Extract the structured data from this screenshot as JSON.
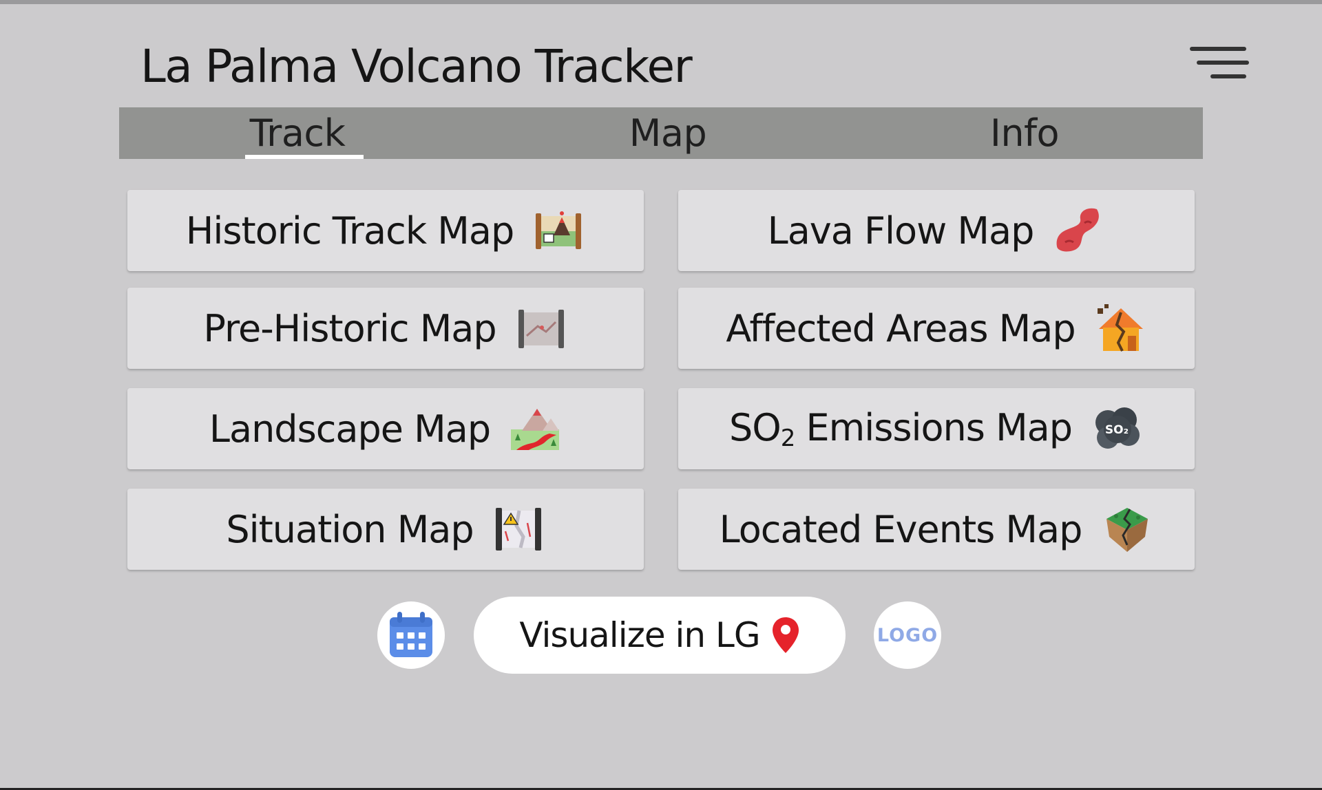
{
  "app": {
    "title": "La Palma Volcano Tracker"
  },
  "tabs": [
    {
      "label": "Track",
      "active": true
    },
    {
      "label": "Map",
      "active": false
    },
    {
      "label": "Info",
      "active": false
    }
  ],
  "track_buttons": {
    "historic": {
      "label": "Historic Track Map",
      "icon": "historic-map-icon"
    },
    "lava_flow": {
      "label": "Lava Flow Map",
      "icon": "lava-flow-icon"
    },
    "prehistoric": {
      "label": "Pre-Historic Map",
      "icon": "prehistoric-map-icon"
    },
    "affected_areas": {
      "label": "Affected Areas Map",
      "icon": "house-damage-icon"
    },
    "landscape": {
      "label": "Landscape Map",
      "icon": "landscape-icon"
    },
    "so2": {
      "label_prefix": "SO",
      "label_sub": "2",
      "label_suffix": " Emissions Map",
      "icon": "so2-cloud-icon",
      "icon_text": "SO₂"
    },
    "situation": {
      "label": "Situation Map",
      "icon": "situation-map-icon"
    },
    "located_events": {
      "label": "Located Events Map",
      "icon": "earthquake-icon"
    }
  },
  "footer": {
    "visualize_label": "Visualize in LG",
    "logo_text": "LOGO",
    "calendar_icon": "calendar-icon",
    "pin_icon": "location-pin-icon"
  },
  "colors": {
    "background": "#cccbcd",
    "tab_bar": "#929391",
    "button": "#e0dfe1",
    "pin": "#e5232b",
    "calendar": "#5b8de8"
  }
}
